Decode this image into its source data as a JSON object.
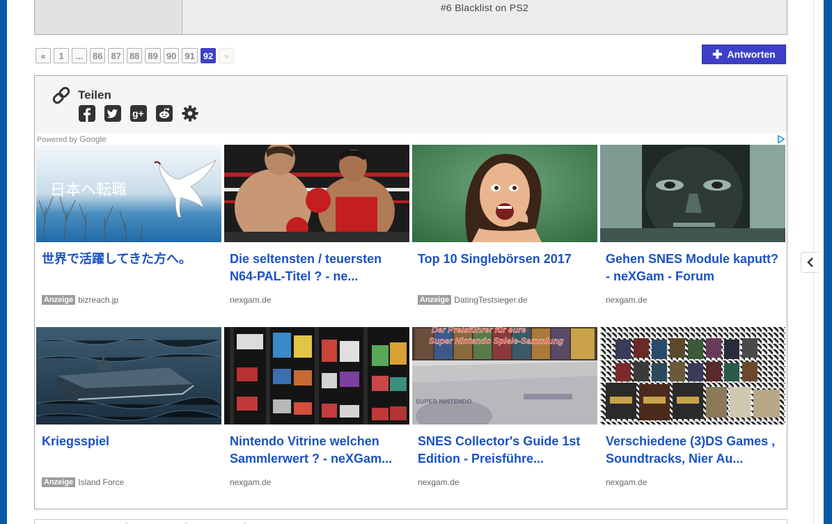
{
  "post": {
    "signature": "#6 Blacklist on PS2"
  },
  "pagination": {
    "first": "«",
    "pages": [
      "1",
      "...",
      "86",
      "87",
      "88",
      "89",
      "90",
      "91",
      "92"
    ],
    "current": "92",
    "next": "»"
  },
  "reply_button": {
    "label": "Antworten"
  },
  "share": {
    "title": "Teilen",
    "icons": [
      "facebook-icon",
      "twitter-icon",
      "google-plus-icon",
      "reddit-icon",
      "settings-icon"
    ]
  },
  "ads": {
    "powered_by": "Powered by",
    "google": "Google",
    "items": [
      {
        "title": "世界で活躍してきた方へ。",
        "badge": "Anzeige",
        "source": "bizreach.jp",
        "thumb_text": "日本へ転職"
      },
      {
        "title": "Die seltensten / teuersten N64-PAL-Titel ? - ne...",
        "badge": "",
        "source": "nexgam.de"
      },
      {
        "title": "Top 10 Singlebörsen 2017",
        "badge": "Anzeige",
        "source": "DatingTestsieger.de"
      },
      {
        "title": "Gehen SNES Module kaputt? - neXGam - Forum",
        "badge": "",
        "source": "nexgam.de"
      },
      {
        "title": "Kriegsspiel",
        "badge": "Anzeige",
        "source": "Island Force"
      },
      {
        "title": "Nintendo Vitrine welchen Sammlerwert ? - neXGam...",
        "badge": "",
        "source": "nexgam.de"
      },
      {
        "title": "SNES Collector's Guide 1st Edition - Preisführe...",
        "badge": "",
        "source": "nexgam.de",
        "thumb_text_1": "Der Preisführer für eure",
        "thumb_text_2": "Super Nintendo Spiele-Sammlung",
        "thumb_text_3": "SUPER NINTENDO"
      },
      {
        "title": "Verschiedene (3)DS Games , Soundtracks, Nier Au...",
        "badge": "",
        "source": "nexgam.de"
      }
    ]
  },
  "colors": {
    "accent": "#3d3fc8",
    "link": "#1a52c4",
    "border_blue": "#0b5aa8"
  }
}
